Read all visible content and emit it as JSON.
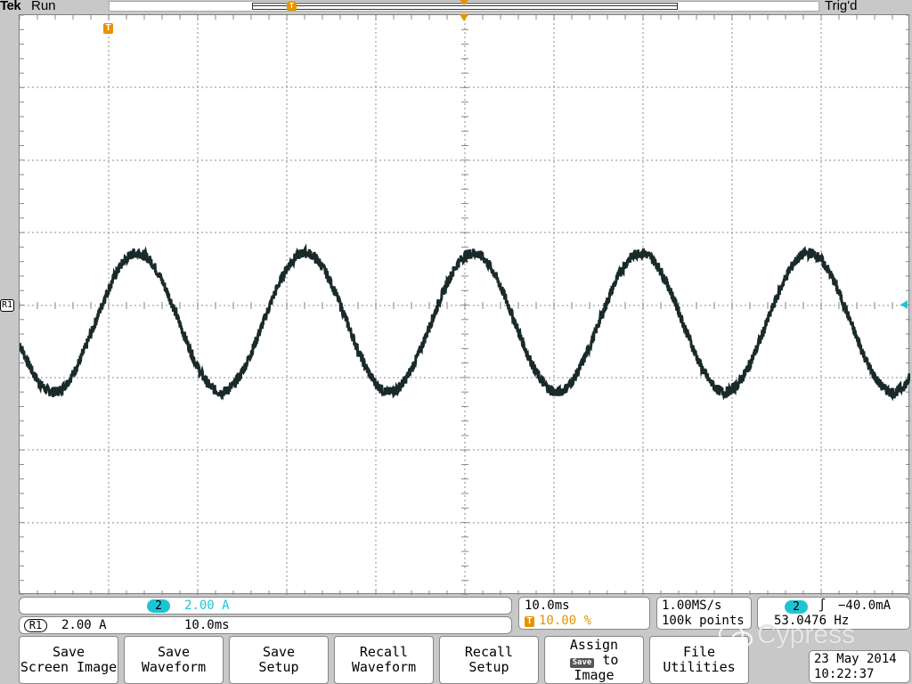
{
  "header": {
    "brand": "Tek",
    "run_status": "Run",
    "trigger_status": "Trig'd"
  },
  "markers": {
    "trigger_position_label": "T",
    "record_trigger_label": "T",
    "ref_label": "R1"
  },
  "channel_panel": {
    "channel_number": "2",
    "channel_scale": "2.00 A",
    "ref_label": "R1",
    "ref_scale": "2.00 A",
    "ref_timebase": "10.0ms"
  },
  "timebase_panel": {
    "time_per_div": "10.0ms",
    "trigger_marker": "T",
    "trigger_position": "10.00 %"
  },
  "acquisition_panel": {
    "sample_rate": "1.00MS/s",
    "record_length": "100k points"
  },
  "trigger_panel": {
    "channel_number": "2",
    "slope_symbol": "∫",
    "level": "−40.0mA",
    "frequency": "53.0476 Hz"
  },
  "softkeys": {
    "save_screen_image": [
      "Save",
      "Screen Image"
    ],
    "save_waveform": [
      "Save",
      "Waveform"
    ],
    "save_setup": [
      "Save",
      "Setup"
    ],
    "recall_waveform": [
      "Recall",
      "Waveform"
    ],
    "recall_setup": [
      "Recall",
      "Setup"
    ],
    "assign_save": [
      "Assign",
      "Save",
      "to",
      "Image"
    ],
    "file_utilities": [
      "File",
      "Utilities"
    ]
  },
  "datetime": {
    "date": "23 May 2014",
    "time": "10:22:37"
  },
  "watermark": {
    "text": "Cypress"
  },
  "colors": {
    "channel2": "#1fc4d4",
    "trigger_marker": "#e59400",
    "waveform": "#1a2a2a",
    "bezel": "#c8c8c8"
  },
  "chart_data": {
    "type": "line",
    "x_unit": "ms",
    "y_unit": "A",
    "x_range": [
      -10,
      90
    ],
    "y_range": [
      -10,
      10
    ],
    "x_divisions": 10,
    "y_divisions": 8,
    "grid": true,
    "series": [
      {
        "channel": "2",
        "frequency_hz": 53.0476,
        "amplitude_a": 2.4,
        "offset_a": -0.6,
        "phase_rad": 0.5,
        "color": "#1a2a2a"
      }
    ]
  }
}
